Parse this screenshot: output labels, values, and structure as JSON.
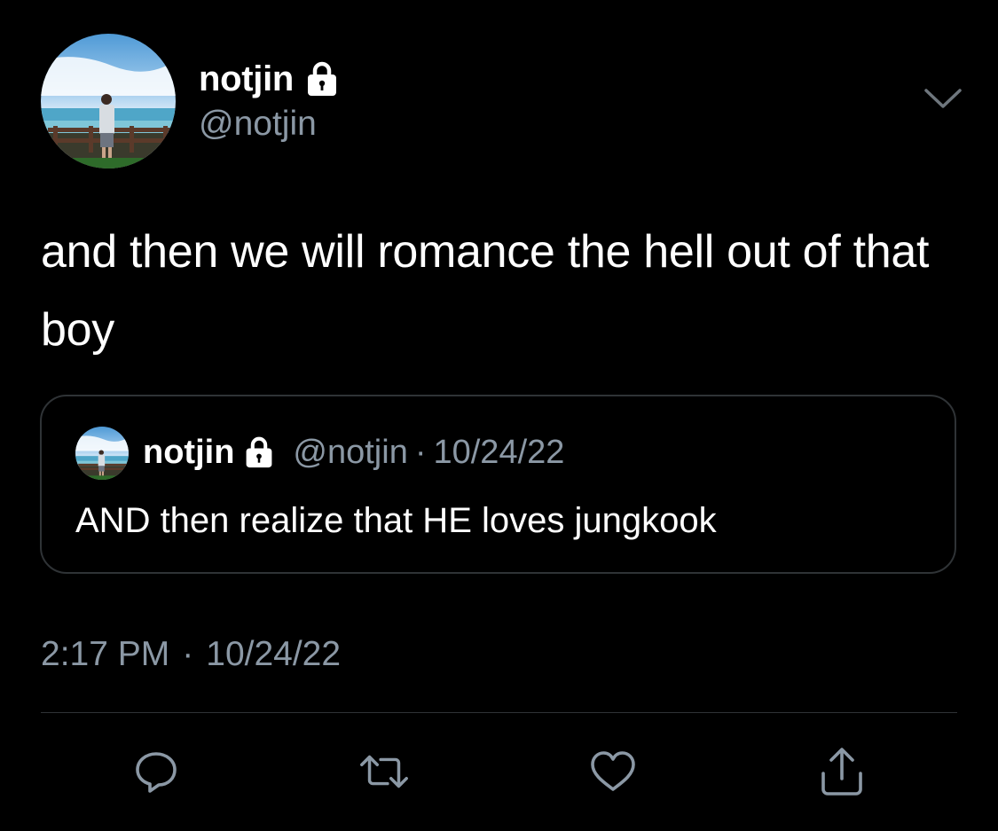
{
  "author": {
    "display_name": "notjin",
    "handle": "@notjin",
    "locked": true,
    "avatar_icon": "profile-photo-person-by-sea-railing"
  },
  "tweet": {
    "text": "and then we will romance the hell out of that boy",
    "time": "2:17 PM",
    "separator": "·",
    "date": "10/24/22"
  },
  "quoted_tweet": {
    "display_name": "notjin",
    "handle": "@notjin",
    "separator": "·",
    "date": "10/24/22",
    "text": "AND then realize that HE loves jungkook"
  },
  "actions": [
    {
      "name": "reply",
      "icon": "reply-icon"
    },
    {
      "name": "retweet",
      "icon": "retweet-icon"
    },
    {
      "name": "like",
      "icon": "heart-icon"
    },
    {
      "name": "share",
      "icon": "share-icon"
    }
  ],
  "colors": {
    "background": "#000000",
    "text_primary": "#ffffff",
    "text_secondary": "#8b98a5",
    "border": "#2f3336",
    "icon": "#8b98a5"
  }
}
